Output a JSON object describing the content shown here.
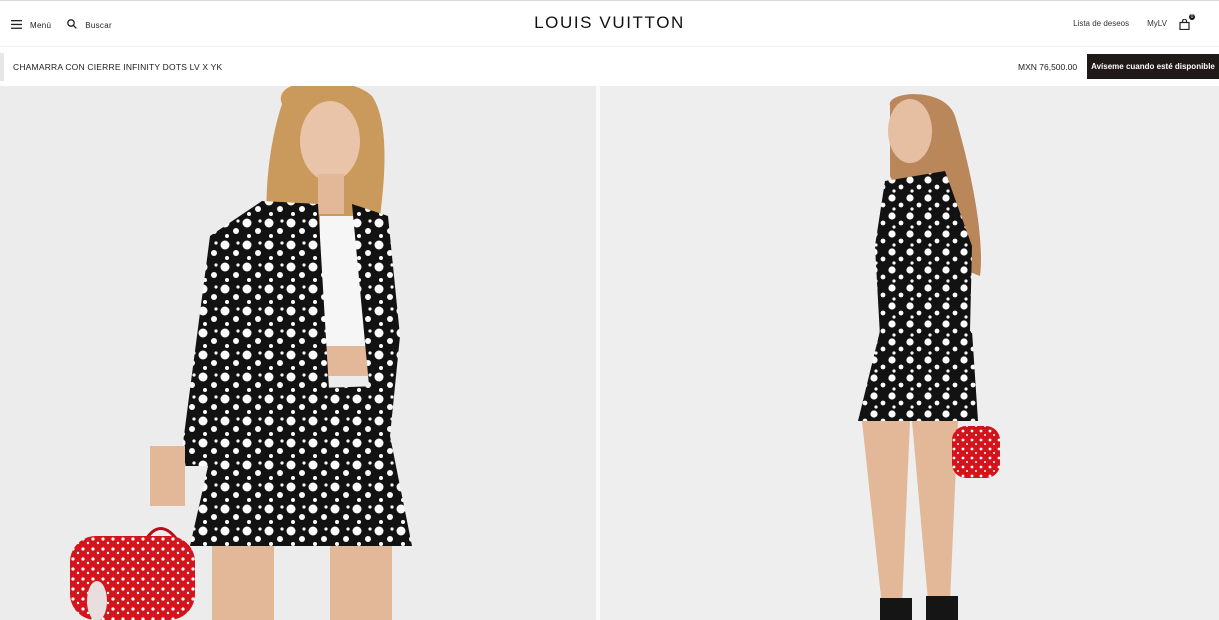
{
  "header": {
    "menu_label": "Menú",
    "search_label": "Buscar",
    "logo": "LOUIS VUITTON",
    "wishlist_label": "Lista de deseos",
    "account_label": "MyLV",
    "cart_count": "0",
    "icons": [
      "menu-icon",
      "search-icon",
      "shopping-bag-icon"
    ]
  },
  "product_bar": {
    "name": "CHAMARRA CON CIERRE INFINITY DOTS LV X YK",
    "price": "MXN 76,500.00",
    "notify_button": "Avíseme cuando esté disponible"
  },
  "gallery": {
    "images": [
      "front-view-model-photo",
      "side-view-model-photo"
    ]
  },
  "colors": {
    "brand_text": "#111111",
    "button_bg": "#1f1a17",
    "button_text": "#ffffff",
    "photo_bg": "#ececec",
    "bag_red": "#d4141c"
  }
}
